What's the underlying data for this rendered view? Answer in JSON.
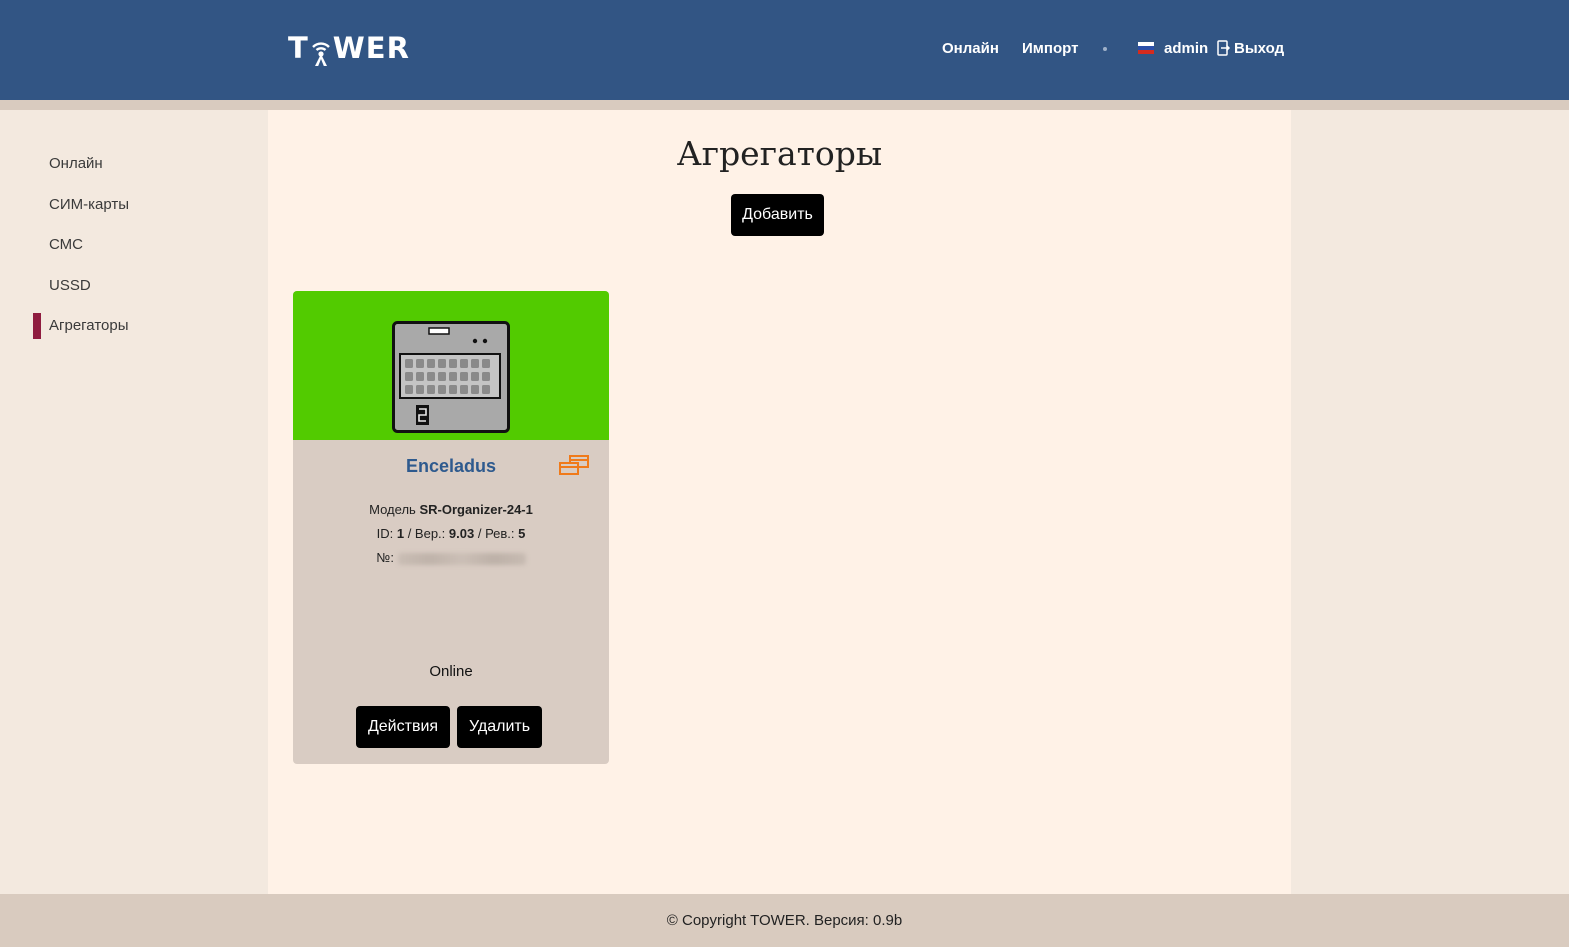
{
  "header": {
    "logo_text_left": "T",
    "logo_text_right": "WER",
    "nav": [
      "Онлайн",
      "Импорт"
    ],
    "user": "admin",
    "logout": "Выход"
  },
  "sidebar": {
    "items": [
      {
        "label": "Онлайн"
      },
      {
        "label": "СИМ-карты"
      },
      {
        "label": "СМС"
      },
      {
        "label": "USSD"
      },
      {
        "label": "Агрегаторы",
        "active": true
      }
    ]
  },
  "main": {
    "title": "Агрегаторы",
    "add_button": "Добавить"
  },
  "card": {
    "name": "Enceladus",
    "model_label": "Модель",
    "model_value": "SR-Organizer-24-1",
    "id_label": "ID:",
    "id_value": "1",
    "ver_label": "/ Вер.:",
    "ver_value": "9.03",
    "rev_label": "/ Рев.:",
    "rev_value": "5",
    "number_label": "№:",
    "status": "Online",
    "actions_button": "Действия",
    "delete_button": "Удалить",
    "header_color": "#52cb00"
  },
  "footer": {
    "text": "© Copyright TOWER. Версия: 0.9b"
  },
  "colors": {
    "header_bg": "#325584",
    "accent": "#8f1c3f",
    "link": "#2e5a8e",
    "icon_orange": "#f07a1a"
  }
}
